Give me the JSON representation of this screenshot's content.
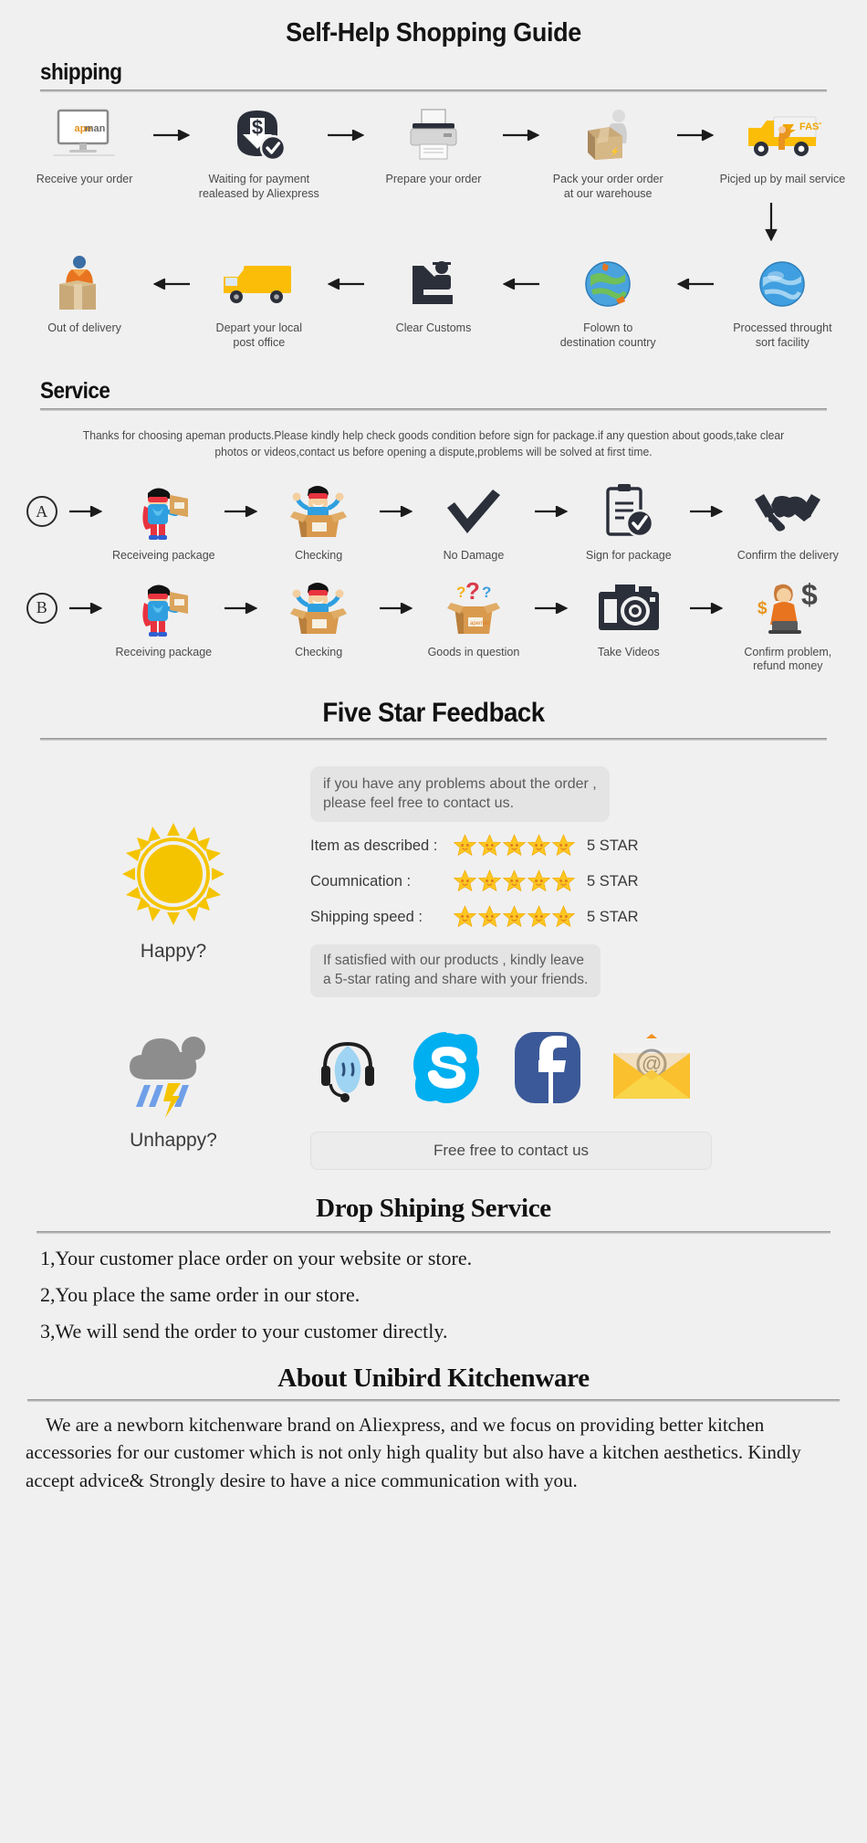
{
  "title": "Self-Help Shopping Guide",
  "shipping": {
    "heading": "shipping",
    "row1": [
      {
        "icon": "monitor-apeman-icon",
        "label": "Receive your order"
      },
      {
        "icon": "payment-released-icon",
        "label": "Waiting for payment\nrealeased by Aliexpress"
      },
      {
        "icon": "printer-icon",
        "label": "Prepare your order"
      },
      {
        "icon": "packing-box-icon",
        "label": "Pack your order order\nat our warehouse"
      },
      {
        "icon": "delivery-truck-fast-icon",
        "label": "Picjed up by mail service"
      }
    ],
    "row2": [
      {
        "icon": "out-for-delivery-icon",
        "label": "Out of delivery"
      },
      {
        "icon": "post-office-truck-icon",
        "label": "Depart your local\npost office"
      },
      {
        "icon": "customs-officer-icon",
        "label": "Clear Customs"
      },
      {
        "icon": "globe-destination-icon",
        "label": "Folown to\ndestination country"
      },
      {
        "icon": "globe-sort-facility-icon",
        "label": "Processed throught\nsort facility"
      }
    ]
  },
  "service": {
    "heading": "Service",
    "note": "Thanks for choosing apeman products.Please kindly help check goods condition before sign for package.if any question about goods,take clear photos or videos,contact us before opening a dispute,problems will be solved at first time.",
    "rowA": {
      "badge": "A",
      "steps": [
        {
          "icon": "superhero-package-icon",
          "label": "Receiveing package"
        },
        {
          "icon": "happy-open-box-icon",
          "label": "Checking"
        },
        {
          "icon": "checkmark-icon",
          "label": "No Damage"
        },
        {
          "icon": "sign-clipboard-icon",
          "label": "Sign for package"
        },
        {
          "icon": "handshake-icon",
          "label": "Confirm the delivery"
        }
      ]
    },
    "rowB": {
      "badge": "B",
      "steps": [
        {
          "icon": "superhero-package-icon",
          "label": "Receiving package"
        },
        {
          "icon": "happy-open-box-icon",
          "label": "Checking"
        },
        {
          "icon": "question-box-icon",
          "label": "Goods in question"
        },
        {
          "icon": "camera-icon",
          "label": "Take Videos"
        },
        {
          "icon": "refund-agent-icon",
          "label": "Confirm problem,\nrefund money"
        }
      ]
    }
  },
  "feedback": {
    "heading": "Five Star Feedback",
    "bubble_top": "if you have any problems about the order ,\nplease feel free to contact us.",
    "sun_label": "Happy?",
    "ratings": [
      {
        "label": "Item as described :",
        "stars": 5,
        "value": "5 STAR"
      },
      {
        "label": "Coumnication :",
        "stars": 5,
        "value": "5 STAR"
      },
      {
        "label": "Shipping speed :",
        "stars": 5,
        "value": "5 STAR"
      }
    ],
    "bubble_bottom": "If satisfied with our products ,  kindly leave\na 5-star rating and share with your friends."
  },
  "contact": {
    "cloud_label": "Unhappy?",
    "icons": [
      {
        "name": "aliexpress-support-icon"
      },
      {
        "name": "skype-icon"
      },
      {
        "name": "facebook-icon"
      },
      {
        "name": "email-icon"
      }
    ],
    "pill": "Free free to contact us"
  },
  "dropshipping": {
    "heading": "Drop Shiping Service",
    "items": [
      "1,Your customer place order on your website or store.",
      "2,You place the same order in our store.",
      "3,We will send the order to your customer directly."
    ]
  },
  "about": {
    "heading": "About Unibird Kitchenware",
    "text": "We are a newborn kitchenware brand on Aliexpress, and we focus on providing better kitchen accessories for our customer which is not only high quality but also have a kitchen aesthetics. Kindly accept advice& Strongly desire to have a nice communication with you."
  },
  "colors": {
    "background": "#f0f0f0",
    "dark": "#2b2f3a",
    "star": "#fcc721",
    "sun": "#f5c400",
    "skype": "#00aff0",
    "facebook": "#3b5998",
    "truck": "#f7b500",
    "orange": "#e07b20"
  }
}
